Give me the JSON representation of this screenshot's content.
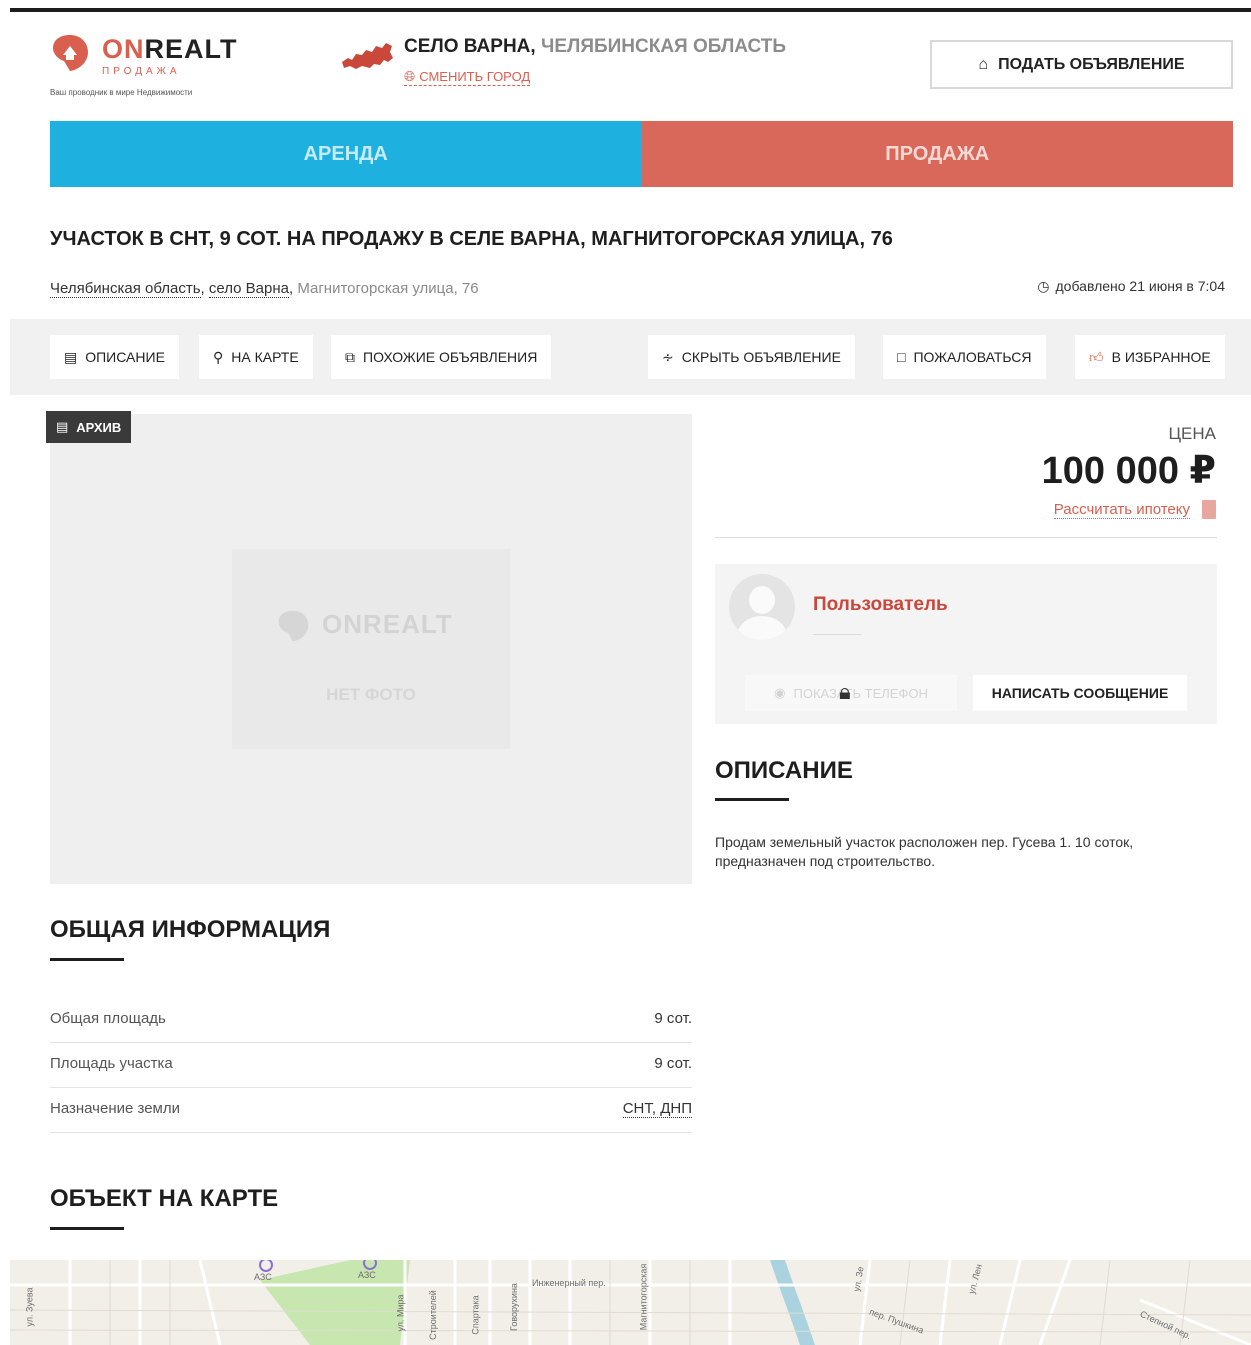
{
  "brand": {
    "name_on": "ON",
    "name_rest": "REALT",
    "section": "ПРОДАЖА",
    "tagline": "Ваш проводник в мире Недвижимости"
  },
  "location": {
    "city": "СЕЛО ВАРНА,",
    "region": "ЧЕЛЯБИНСКАЯ ОБЛАСТЬ",
    "change_city": "СМЕНИТЬ ГОРОД"
  },
  "header": {
    "post_button": "ПОДАТЬ ОБЪЯВЛЕНИЕ"
  },
  "tabs": [
    {
      "label": "АРЕНДА"
    },
    {
      "label": "ПРОДАЖА"
    }
  ],
  "listing": {
    "title": "УЧАСТОК В СНТ, 9 СОТ. НА ПРОДАЖУ В СЕЛЕ ВАРНА, МАГНИТОГОРСКАЯ УЛИЦА, 76",
    "address_region": "Челябинская область",
    "address_city": "село Варна",
    "address_street": "Магнитогорская улица, 76",
    "added": "добавлено 21 июня в 7:04"
  },
  "actions": {
    "description": "ОПИСАНИЕ",
    "on_map": "НА КАРТЕ",
    "similar": "ПОХОЖИЕ ОБЪЯВЛЕНИЯ",
    "hide": "СКРЫТЬ ОБЪЯВЛЕНИЕ",
    "complain": "ПОЖАЛОВАТЬСЯ",
    "favorite": "В ИЗБРАННОЕ"
  },
  "photo": {
    "badge": "АРХИВ",
    "placeholder_logo": "ONREALT",
    "placeholder_text": "НЕТ ФОТО"
  },
  "price": {
    "label": "ЦЕНА",
    "value": "100 000 ₽",
    "mortgage": "Рассчитать ипотеку"
  },
  "seller": {
    "name": "Пользователь",
    "phone_button": "ПОКАЗАТЬ ТЕЛЕФОН",
    "message_button": "НАПИСАТЬ СООБЩЕНИЕ"
  },
  "description": {
    "heading": "ОПИСАНИЕ",
    "text": "Продам земельный участок расположен пер. Гусева 1. 10 соток, предназначен под строительство."
  },
  "general": {
    "heading": "ОБЩАЯ ИНФОРМАЦИЯ",
    "rows": [
      {
        "label": "Общая площадь",
        "value": "9 сот."
      },
      {
        "label": "Площадь участка",
        "value": "9 сот."
      },
      {
        "label": "Назначение земли",
        "value": "СНТ, ДНП"
      }
    ]
  },
  "map": {
    "heading": "ОБЪЕКТ НА КАРТЕ",
    "labels": [
      "ул. Зуева",
      "АЗС",
      "АЗС",
      "ул. Мира",
      "Строителей",
      "Спартака",
      "Говорухина",
      "Инженерный пер.",
      "Магнитогорская",
      "ул. Зе",
      "пер. Пушкина",
      "ул. Лен",
      "Степной пер."
    ]
  }
}
